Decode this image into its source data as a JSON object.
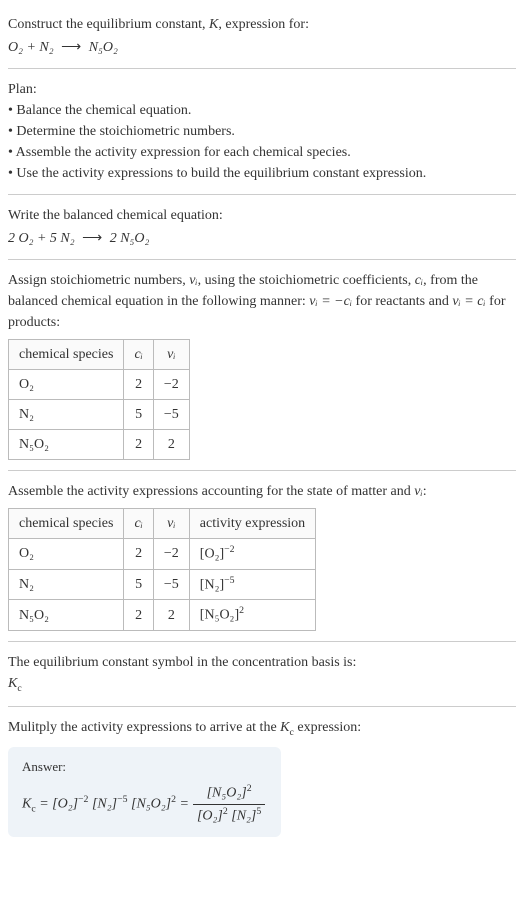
{
  "intro": {
    "line1_prefix": "Construct the equilibrium constant, ",
    "line1_k": "K",
    "line1_suffix": ", expression for:",
    "eq_left": "O₂ + N₂",
    "eq_arrow": "⟶",
    "eq_right": "N₅O₂"
  },
  "plan": {
    "title": "Plan:",
    "items": [
      "Balance the chemical equation.",
      "Determine the stoichiometric numbers.",
      "Assemble the activity expression for each chemical species.",
      "Use the activity expressions to build the equilibrium constant expression."
    ]
  },
  "balanced": {
    "title": "Write the balanced chemical equation:",
    "eq_left": "2 O₂ + 5 N₂",
    "eq_arrow": "⟶",
    "eq_right": "2 N₅O₂"
  },
  "stoich": {
    "text_a": "Assign stoichiometric numbers, ",
    "nu_i": "νᵢ",
    "text_b": ", using the stoichiometric coefficients, ",
    "c_i": "cᵢ",
    "text_c": ", from the balanced chemical equation in the following manner: ",
    "rel1": "νᵢ = −cᵢ",
    "text_d": " for reactants and ",
    "rel2": "νᵢ = cᵢ",
    "text_e": " for products:",
    "headers": [
      "chemical species",
      "cᵢ",
      "νᵢ"
    ],
    "rows": [
      {
        "species": "O₂",
        "c": "2",
        "nu": "−2"
      },
      {
        "species": "N₂",
        "c": "5",
        "nu": "−5"
      },
      {
        "species": "N₅O₂",
        "c": "2",
        "nu": "2"
      }
    ]
  },
  "activity": {
    "text_a": "Assemble the activity expressions accounting for the state of matter and ",
    "nu_i": "νᵢ",
    "text_b": ":",
    "headers": [
      "chemical species",
      "cᵢ",
      "νᵢ",
      "activity expression"
    ],
    "rows": [
      {
        "species": "O₂",
        "c": "2",
        "nu": "−2",
        "expr_base": "[O₂]",
        "expr_exp": "−2"
      },
      {
        "species": "N₂",
        "c": "5",
        "nu": "−5",
        "expr_base": "[N₂]",
        "expr_exp": "−5"
      },
      {
        "species": "N₅O₂",
        "c": "2",
        "nu": "2",
        "expr_base": "[N₅O₂]",
        "expr_exp": "2"
      }
    ]
  },
  "kc_symbol": {
    "text": "The equilibrium constant symbol in the concentration basis is:",
    "sym": "K",
    "sub": "c"
  },
  "mult": {
    "text_a": "Mulitply the activity expressions to arrive at the ",
    "kc_k": "K",
    "kc_c": "c",
    "text_b": " expression:"
  },
  "answer": {
    "label": "Answer:",
    "kc_k": "K",
    "kc_c": "c",
    "eq1_t1_base": "[O₂]",
    "eq1_t1_exp": "−2",
    "eq1_t2_base": "[N₂]",
    "eq1_t2_exp": "−5",
    "eq1_t3_base": "[N₅O₂]",
    "eq1_t3_exp": "2",
    "frac_num_base": "[N₅O₂]",
    "frac_num_exp": "2",
    "frac_den_t1_base": "[O₂]",
    "frac_den_t1_exp": "2",
    "frac_den_t2_base": "[N₂]",
    "frac_den_t2_exp": "5"
  }
}
